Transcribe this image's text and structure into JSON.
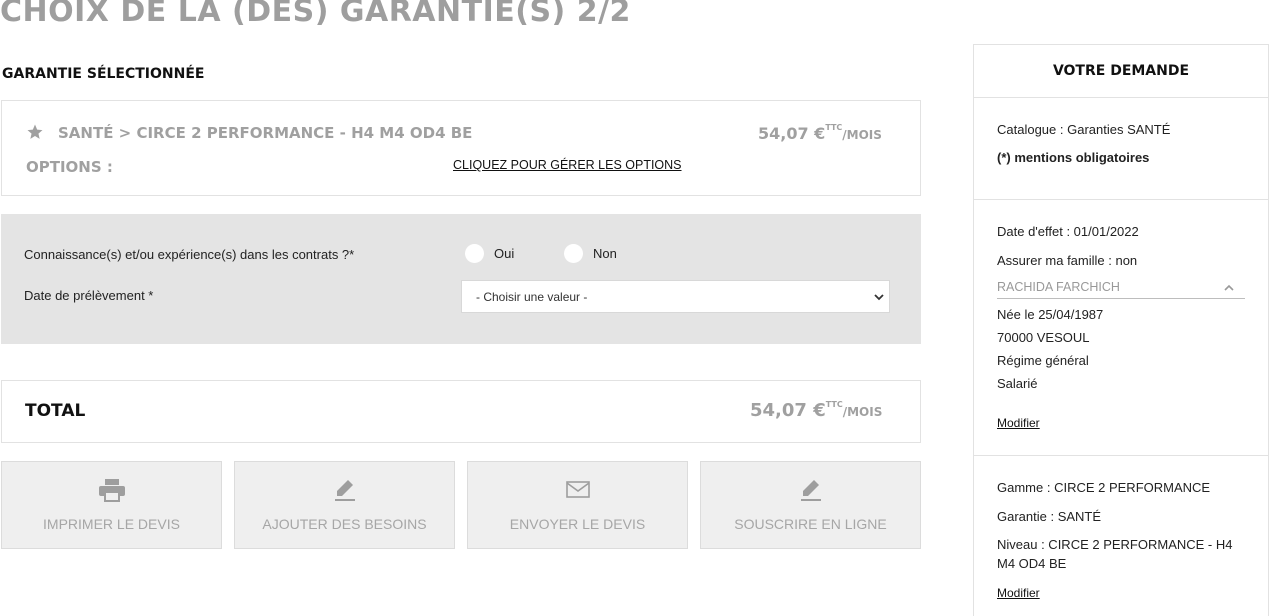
{
  "page": {
    "title": "CHOIX DE LA (DES) GARANTIE(S) 2/2"
  },
  "selected": {
    "section_title": "GARANTIE SÉLECTIONNÉE",
    "guarantee_name": "SANTÉ > CIRCE 2 PERFORMANCE - H4 M4 OD4 BE",
    "price_amount": "54,07 €",
    "price_ttc": "TTC",
    "price_period": "/MOIS",
    "options_label": "OPTIONS :",
    "options_link": "CLIQUEZ POUR GÉRER LES OPTIONS",
    "icon": "star-icon"
  },
  "form": {
    "knowledge_label": "Connaissance(s) et/ou expérience(s) dans les contrats ?*",
    "yes_label": "Oui",
    "no_label": "Non",
    "date_label": "Date de prélèvement *",
    "date_select_value": "- Choisir une valeur -"
  },
  "total": {
    "label": "TOTAL",
    "amount": "54,07 €",
    "ttc": "TTC",
    "period": "/MOIS"
  },
  "actions": [
    {
      "label": "IMPRIMER LE DEVIS",
      "icon": "printer-icon"
    },
    {
      "label": "AJOUTER DES BESOINS",
      "icon": "pencil-icon"
    },
    {
      "label": "ENVOYER LE DEVIS",
      "icon": "envelope-icon"
    },
    {
      "label": "SOUSCRIRE EN LIGNE",
      "icon": "pencil-icon"
    }
  ],
  "sidebar": {
    "title": "VOTRE DEMANDE",
    "catalogue": "Catalogue : Garanties SANTÉ",
    "mandatory": "(*) mentions obligatoires",
    "date_effet": "Date d'effet : 01/01/2022",
    "assurer_famille": "Assurer ma famille : non",
    "person_name": "RACHIDA FARCHICH",
    "birth": "Née le 25/04/1987",
    "city": "70000 VESOUL",
    "regime": "Régime général",
    "status": "Salarié",
    "modify_label": "Modifier",
    "gamme": "Gamme : CIRCE 2 PERFORMANCE",
    "garantie": "Garantie : SANTÉ",
    "niveau_line1": "Niveau : CIRCE 2 PERFORMANCE - H4",
    "niveau_line2": "M4 OD4 BE"
  },
  "colors": {
    "muted_text": "#a0a0a0",
    "panel_bg": "#e4e4e4",
    "button_bg": "#efefef"
  }
}
